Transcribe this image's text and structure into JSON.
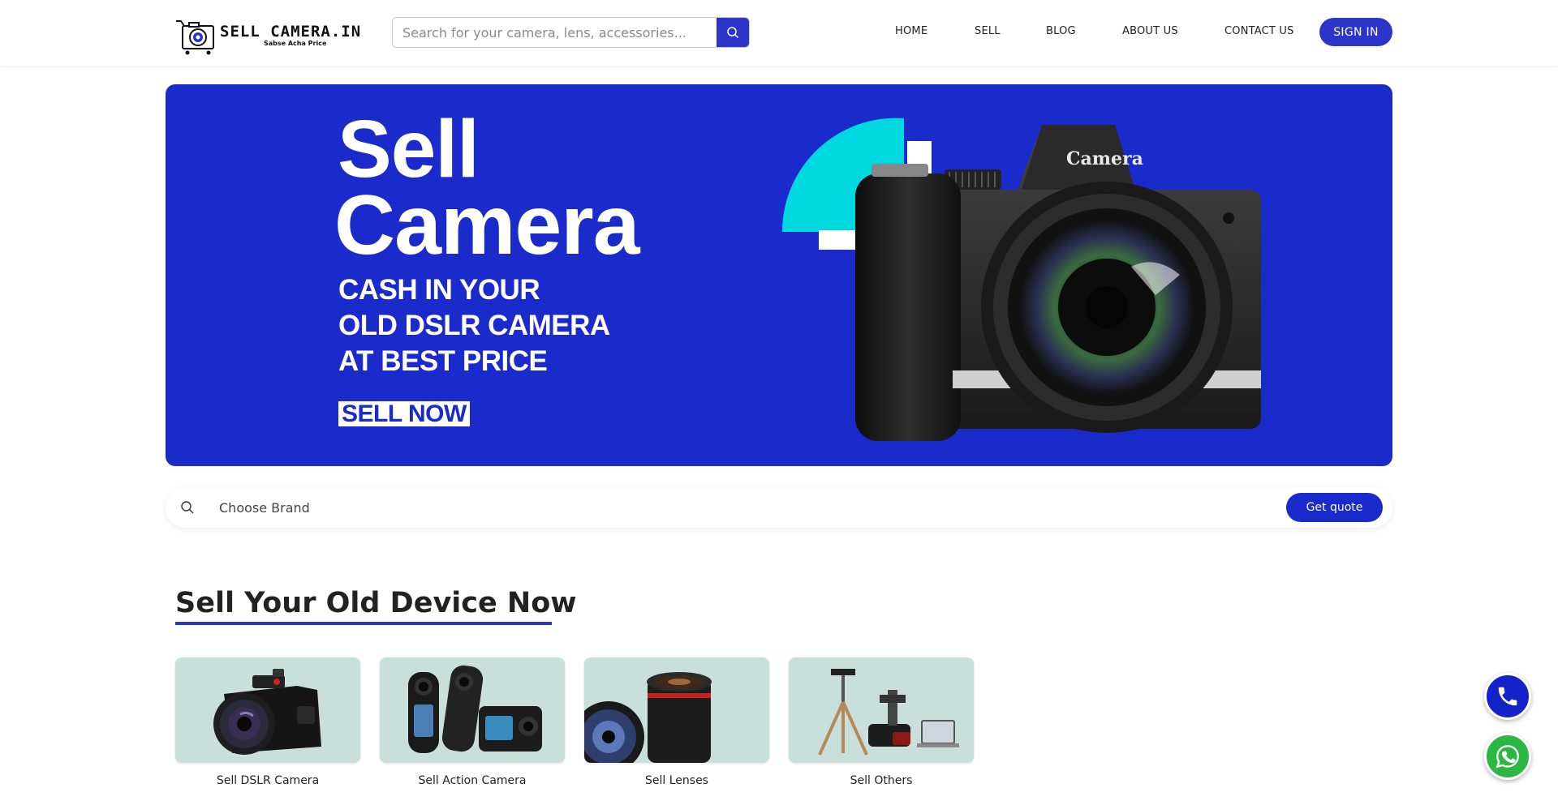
{
  "header": {
    "logo_name": "SELL CAMERA.IN",
    "logo_tagline": "Sabse Acha Price",
    "search_placeholder": "Search for your camera, lens, accessories...",
    "nav": [
      {
        "label": "HOME"
      },
      {
        "label": "SELL"
      },
      {
        "label": "BLOG"
      },
      {
        "label": "ABOUT US"
      },
      {
        "label": "CONTACT US"
      }
    ],
    "signin_label": "SIGN IN"
  },
  "banner": {
    "title_line1": "Sell",
    "title_line2": "Camera",
    "subtitle_lines": [
      "CASH IN YOUR",
      "OLD DSLR CAMERA",
      "AT BEST PRICE"
    ],
    "cta": "SELL NOW",
    "camera_label": "Camera",
    "colors": {
      "background": "#1a2acb",
      "accent": "#00d8e0"
    }
  },
  "brand_bar": {
    "placeholder": "Choose Brand",
    "quote_label": "Get quote"
  },
  "section": {
    "title": "Sell Your Old Device Now",
    "cards": [
      {
        "label": "Sell DSLR Camera",
        "icon": "dslr-camera"
      },
      {
        "label": "Sell Action Camera",
        "icon": "action-camera"
      },
      {
        "label": "Sell Lenses",
        "icon": "camera-lens"
      },
      {
        "label": "Sell Others",
        "icon": "accessories"
      }
    ]
  },
  "floating": {
    "phone_icon": "phone-icon",
    "whatsapp_icon": "whatsapp-icon"
  },
  "theme": {
    "primary": "#2b35c9",
    "card_bg": "#c8e0d9",
    "whatsapp": "#2bb741"
  }
}
